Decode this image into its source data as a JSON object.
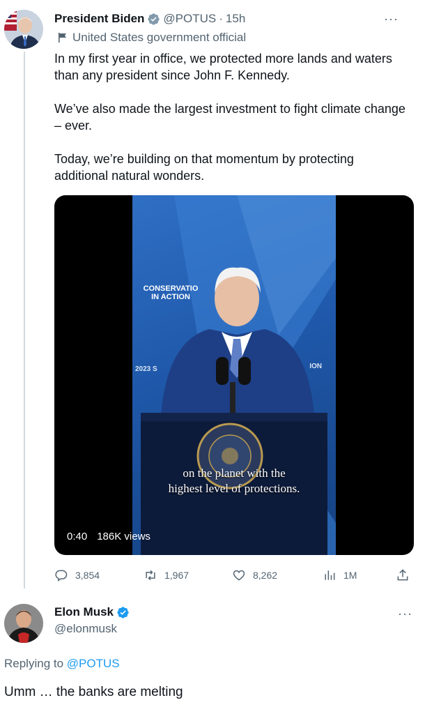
{
  "tweet": {
    "author_name": "President Biden",
    "author_handle": "@POTUS",
    "separator": "·",
    "time": "15h",
    "more": "···",
    "label": "United States government official",
    "paragraphs": [
      "In my first year in office, we protected more lands and waters than any president since John F. Kennedy.",
      "We’ve also made the largest investment to fight climate change – ever.",
      "Today, we’re building on that momentum by protecting additional natural wonders."
    ],
    "video": {
      "banner_line1": "CONSERVATIO",
      "banner_line2": "IN ACTION",
      "banner_year": "2023 S",
      "banner_right": "ION",
      "caption_line1": "on the planet with the",
      "caption_line2": "highest level of protections.",
      "duration": "0:40",
      "views": "186K views"
    },
    "stats": {
      "replies": "3,854",
      "retweets": "1,967",
      "likes": "8,262",
      "views": "1M"
    }
  },
  "reply": {
    "author_name": "Elon Musk",
    "author_handle": "@elonmusk",
    "more": "···",
    "replying_prefix": "Replying to",
    "replying_to": "@POTUS",
    "text": "Umm … the banks are melting"
  },
  "colors": {
    "verified_gray": "#829aab",
    "verified_blue": "#1d9bf0",
    "muted": "#536471",
    "link": "#1d9bf0"
  }
}
